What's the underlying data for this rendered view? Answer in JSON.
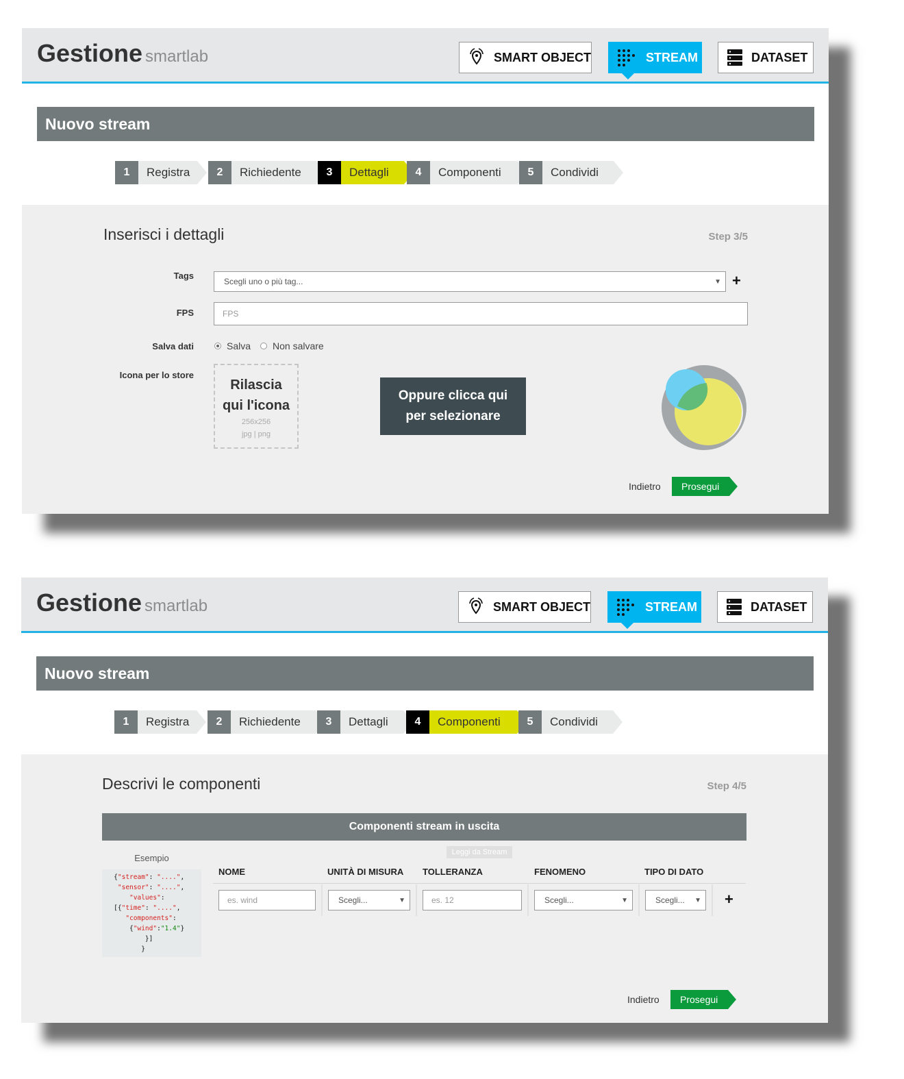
{
  "header": {
    "brand_main": "Gestione",
    "brand_sub": "smartlab",
    "nav": [
      {
        "label": "SMART OBJECT",
        "icon": "location-signal-icon"
      },
      {
        "label": "STREAM",
        "icon": "dots-grid-icon",
        "active": true
      },
      {
        "label": "DATASET",
        "icon": "database-icon"
      }
    ]
  },
  "page_title": "Nuovo stream",
  "steps": [
    {
      "num": "1",
      "label": "Registra"
    },
    {
      "num": "2",
      "label": "Richiedente"
    },
    {
      "num": "3",
      "label": "Dettagli"
    },
    {
      "num": "4",
      "label": "Componenti"
    },
    {
      "num": "5",
      "label": "Condividi"
    }
  ],
  "screen1": {
    "active_step": 3,
    "heading": "Inserisci i dettagli",
    "step_of": "Step 3/5",
    "tags_label": "Tags",
    "tags_placeholder": "Scegli uno o più tag...",
    "fps_label": "FPS",
    "fps_placeholder": "FPS",
    "save_label": "Salva dati",
    "save_options": [
      "Salva",
      "Non salvare"
    ],
    "save_selected": "Salva",
    "icon_label": "Icona per lo store",
    "drop_title_1": "Rilascia",
    "drop_title_2": "qui l'icona",
    "drop_size": "256x256",
    "drop_types": "jpg | png",
    "choose_1": "Oppure clicca qui",
    "choose_2": "per selezionare",
    "back": "Indietro",
    "next": "Prosegui"
  },
  "screen2": {
    "active_step": 4,
    "heading": "Descrivi le componenti",
    "step_of": "Step 4/5",
    "bar_title": "Componenti stream in uscita",
    "example_label": "Esempio",
    "read_from_stream": "Leggi da Stream",
    "columns": [
      "NOME",
      "UNITÀ DI MISURA",
      "TOLLERANZA",
      "FENOMENO",
      "TIPO DI DATO"
    ],
    "name_placeholder": "es. wind",
    "unit_select": "Scegli...",
    "tolerance_placeholder": "es. 12",
    "phenomenon_select": "Scegli...",
    "datatype_select": "Scegli...",
    "back": "Indietro",
    "next": "Prosegui"
  },
  "colors": {
    "accent": "#00b5ef",
    "active_step": "#d9dd00",
    "next_button": "#0b9a3c",
    "title_bar": "#727a7c"
  }
}
